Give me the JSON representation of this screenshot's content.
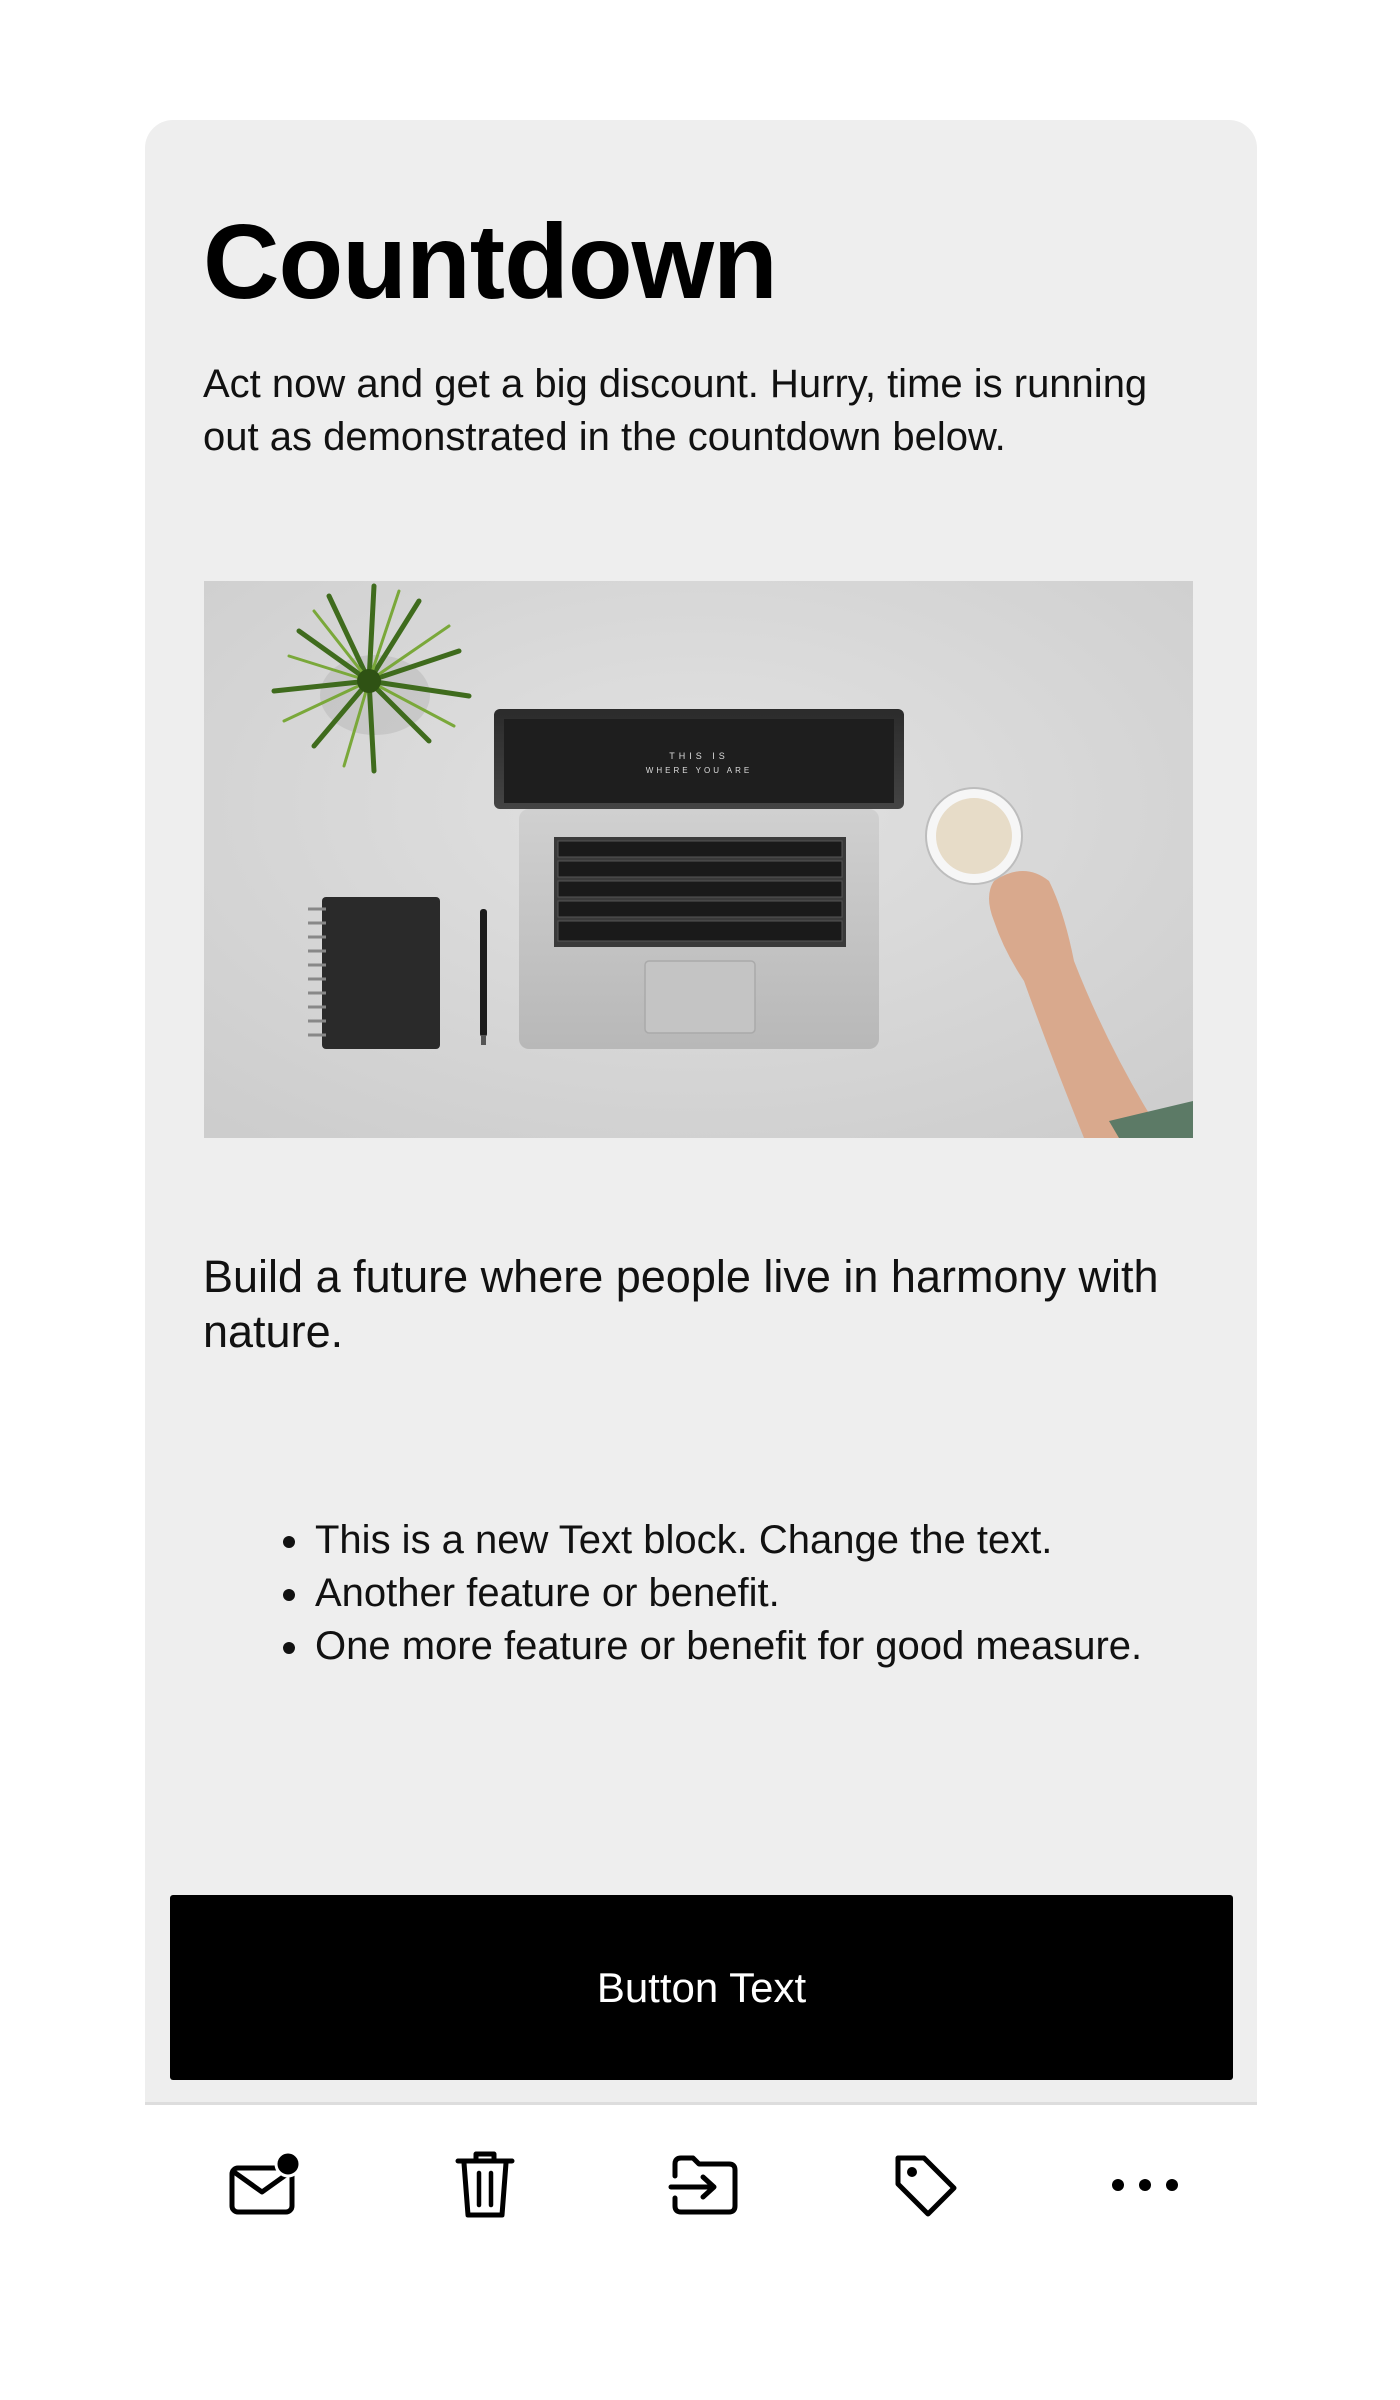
{
  "email": {
    "title": "Countdown",
    "intro": "Act now and get a big discount. Hurry, time is running out as demonstrated in the countdown below.",
    "hero_image": {
      "screen_text_line1": "THIS IS",
      "screen_text_line2": "WHERE YOU ARE"
    },
    "tagline": "Build a future where people live in harmony with nature.",
    "features": [
      "This is a new Text block. Change the text.",
      "Another feature or benefit.",
      "One more feature or benefit for good measure."
    ],
    "button_label": "Button Text"
  },
  "toolbar": {
    "items": [
      {
        "icon": "mail-unread-icon"
      },
      {
        "icon": "trash-icon"
      },
      {
        "icon": "move-to-folder-icon"
      },
      {
        "icon": "tag-icon"
      },
      {
        "icon": "more-icon"
      }
    ]
  },
  "colors": {
    "card_background": "#eeeeee",
    "button_background": "#000000",
    "button_text": "#ffffff",
    "text": "#111111"
  }
}
